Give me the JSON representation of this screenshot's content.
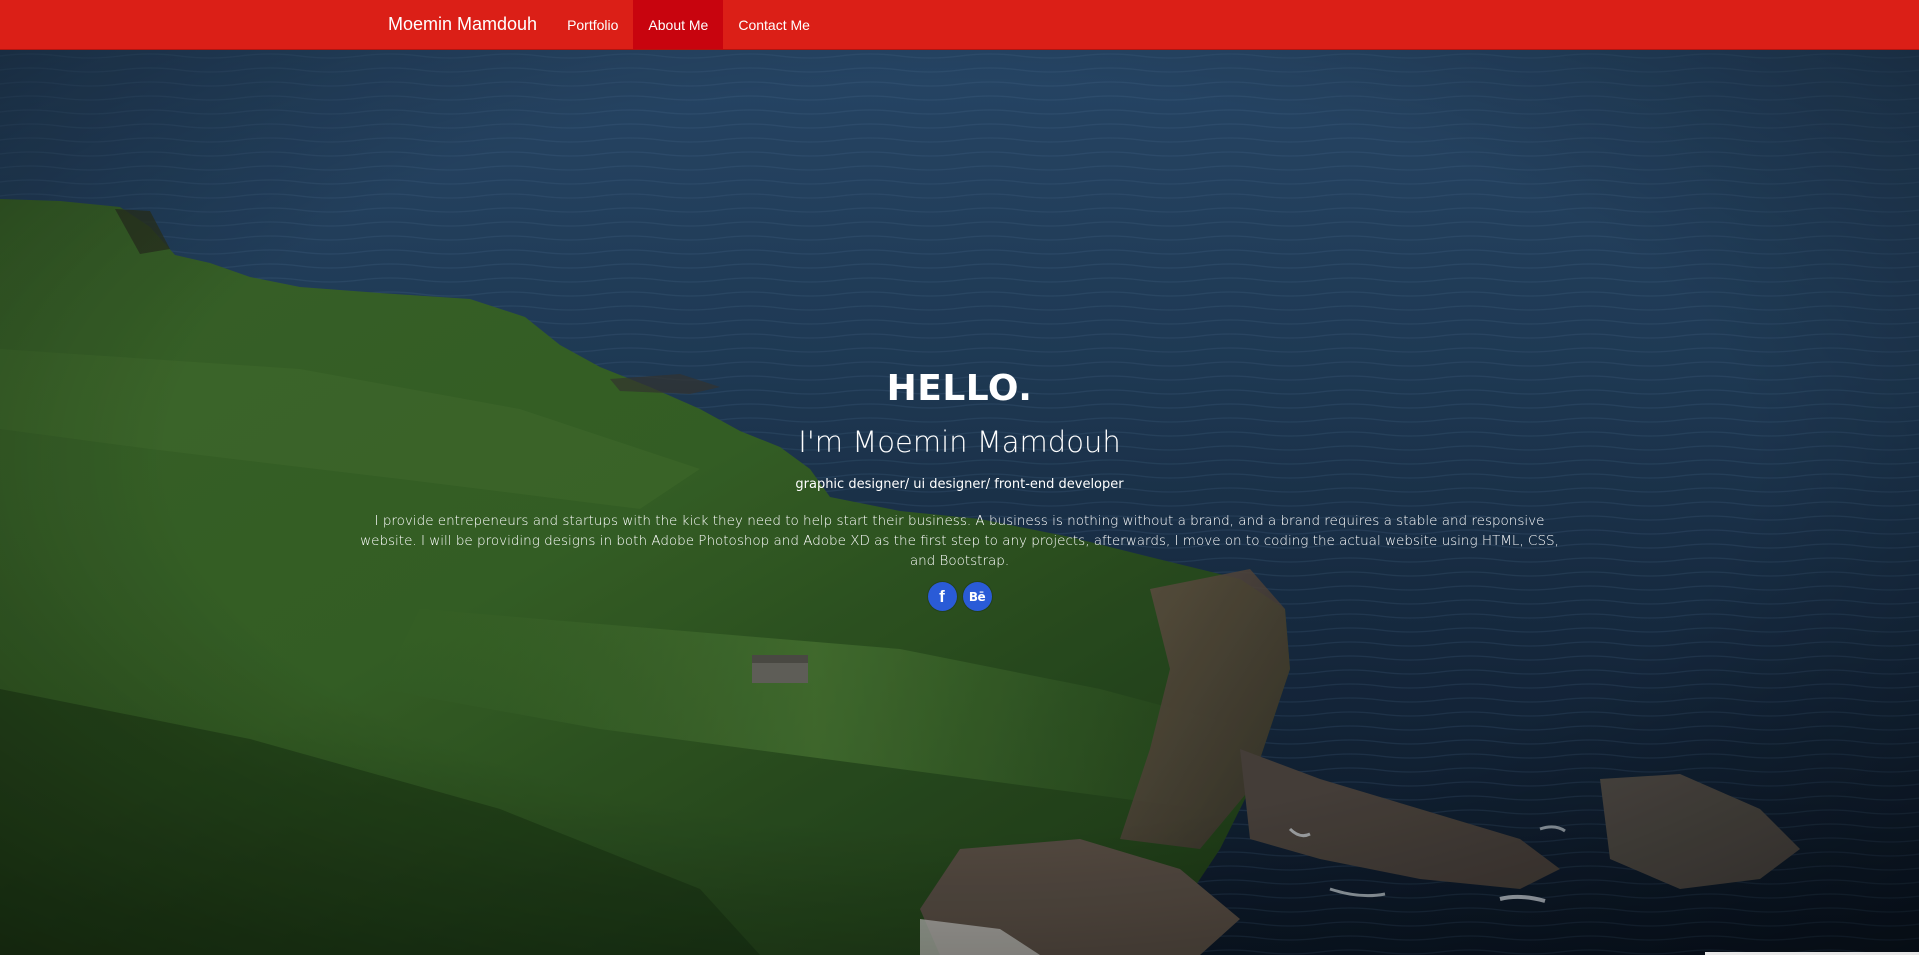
{
  "nav": {
    "brand": "Moemin Mamdouh",
    "links": [
      {
        "label": "Portfolio",
        "active": false
      },
      {
        "label": "About Me",
        "active": true
      },
      {
        "label": "Contact Me",
        "active": false
      }
    ]
  },
  "hero": {
    "greeting": "HELLO.",
    "name": "I'm Moemin Mamdouh",
    "roles": "graphic designer/ ui designer/ front-end developer",
    "description": "I provide entrepeneurs and startups with the kick they need to help start their business. A business is nothing without a brand, and a brand requires a stable and responsive website. I will be providing designs in both Adobe Photoshop and Adobe XD as the first step to any projects, afterwards, I move on to coding the actual website using HTML, CSS, and Bootstrap.",
    "social": [
      {
        "name": "facebook",
        "glyph": "f",
        "icon": "facebook-icon"
      },
      {
        "name": "behance",
        "glyph": "Bē",
        "icon": "behance-icon"
      }
    ]
  },
  "colors": {
    "navbar": "#db1f17",
    "nav_active": "#c8040e",
    "social_button": "#2a5bd7",
    "sea": "#1e3a57",
    "grass": "#3d6a2c"
  }
}
